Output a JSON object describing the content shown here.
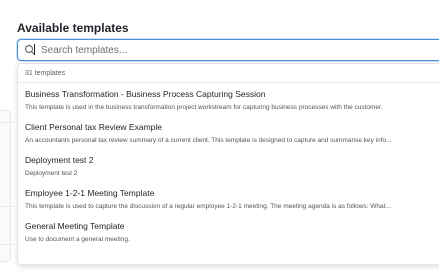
{
  "section": {
    "title": "Available templates"
  },
  "search": {
    "placeholder": "Search templates..."
  },
  "dropdown": {
    "count_label": "31 templates",
    "items": [
      {
        "title": "Business Transformation - Business Process Capturing Session",
        "description": "This template is used in the business transformation project workstream for capturing business processes with the customer."
      },
      {
        "title": "Client Personal tax Review Example",
        "description": "An accountants personal tax review summary of a current client. This template is designed to capture and summarise key info..."
      },
      {
        "title": "Deployment test 2",
        "description": "Deployment test 2"
      },
      {
        "title": "Employee 1-2-1 Meeting Template",
        "description": "This template is used to capture the discussion of a regular employee 1-2-1 meeting. The meeting agenda is as follows: What..."
      },
      {
        "title": "General Meeting Template",
        "description": "Use to document a general meeting."
      }
    ]
  },
  "icons": {
    "search": "search-icon",
    "scroll_up": "chevron-up-icon",
    "scroll_down": "chevron-down-icon"
  },
  "colors": {
    "accent": "#4a90d9",
    "text": "#1f2328",
    "muted": "#50565c"
  }
}
